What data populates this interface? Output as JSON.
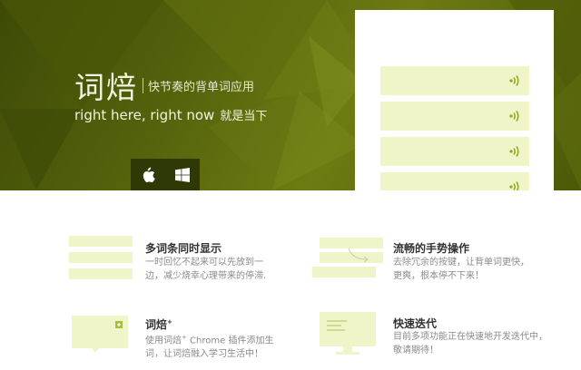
{
  "hero": {
    "brand": "词焙",
    "tagline": "快节奏的背单词应用",
    "slogan_en": "right here, right now",
    "slogan_cn": "就是当下",
    "platforms": [
      {
        "name": "apple",
        "icon": "apple-icon"
      },
      {
        "name": "windows",
        "icon": "windows-icon"
      }
    ],
    "colors": {
      "accent": "#5a660e",
      "card": "#f0f4c9",
      "wave": "#8da81a"
    }
  },
  "phone": {
    "cards": [
      {
        "icon": "sound-wave-icon"
      },
      {
        "icon": "sound-wave-icon"
      },
      {
        "icon": "sound-wave-icon"
      },
      {
        "icon": "sound-wave-icon"
      }
    ]
  },
  "features": [
    {
      "title": "多词条同时显示",
      "desc_line1": "一时回忆不起来可以先放到一",
      "desc_line2": "边，减少烧幸心理带来的停滞."
    },
    {
      "title": "流畅的手势操作",
      "desc_line1": "去除冗余的按键，让背单词更快，",
      "desc_line2": "更爽，根本停不下来！"
    },
    {
      "title": "词焙",
      "title_sup": "+",
      "desc_line1_a": "使用词焙",
      "desc_line1_sup": "+",
      "desc_line1_b": " Chrome 插件添加生",
      "desc_line2": "词，让词焙融入学习生活中！"
    },
    {
      "title": "快速迭代",
      "desc_line1": "目前多项功能正在快速地开发迭代中，",
      "desc_line2": "敬请期待！"
    }
  ]
}
